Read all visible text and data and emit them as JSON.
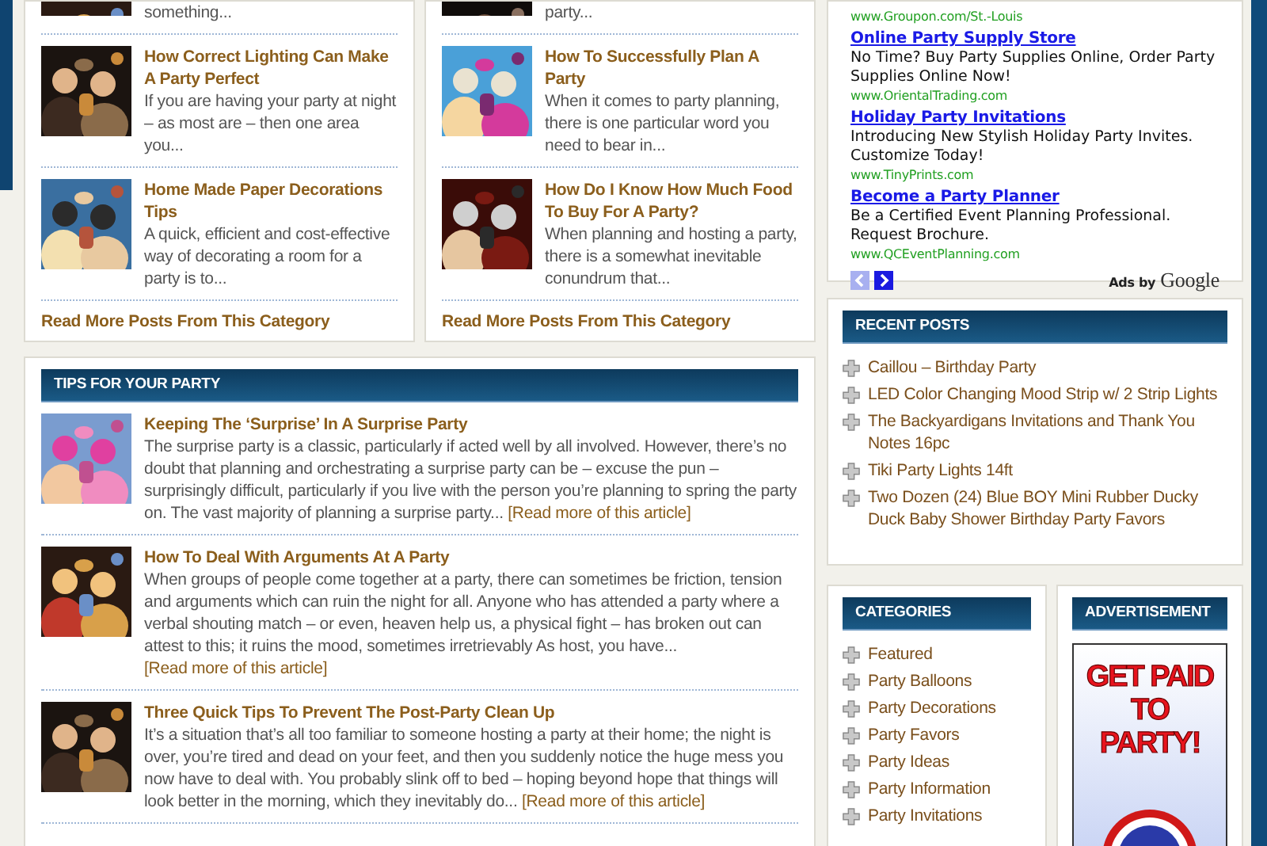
{
  "category_boxes": [
    {
      "posts": [
        {
          "kind": "partial",
          "excerpt": "something..."
        },
        {
          "kind": "post",
          "title": "How Correct Lighting Can Make A Party Perfect",
          "excerpt": "If you are having your party at night – as most are – then one area you..."
        },
        {
          "kind": "post",
          "title": "Home Made Paper Decorations Tips",
          "excerpt": "A quick, efficient and cost-effective way of decorating a room for a party is to..."
        }
      ],
      "read_more": "Read More Posts From This Category"
    },
    {
      "posts": [
        {
          "kind": "partial",
          "excerpt": "party..."
        },
        {
          "kind": "post",
          "title": "How To Successfully Plan A Party",
          "excerpt": "When it comes to party planning, there is one particular word you need to bear in..."
        },
        {
          "kind": "post",
          "title": "How Do I Know How Much Food To Buy For A Party?",
          "excerpt": "When planning and hosting a party, there is a somewhat inevitable conundrum that..."
        }
      ],
      "read_more": "Read More Posts From This Category"
    }
  ],
  "tips": {
    "title": "TIPS FOR YOUR PARTY",
    "posts": [
      {
        "title": "Keeping The ‘Surprise’ In A Surprise Party",
        "excerpt": "The surprise party is a classic, particularly if acted well by all involved. However, there’s no doubt that planning and orchestrating a surprise party can be – excuse the pun – surprisingly difficult, particularly if you live with the person you’re planning to spring the party on. The vast majority of planning a surprise party...",
        "read_more": "[Read more of this article]"
      },
      {
        "title": "How To Deal With Arguments At A Party",
        "excerpt": "When groups of people come together at a party, there can sometimes be friction, tension and arguments which can ruin the night for all. Anyone who has attended a party where a verbal shouting match – or even, heaven help us, a physical fight – has broken out can attest to this; it ruins the mood, sometimes irretrievably As host, you have...",
        "read_more": "[Read more of this article]"
      },
      {
        "title": "Three Quick Tips To Prevent The Post-Party Clean Up",
        "excerpt": "It’s a situation that’s all too familiar to someone hosting a party at their home; the night is over, you’re tired and dead on your feet, and then you suddenly notice the huge mess you now have to deal with. You probably slink off to bed – hoping beyond hope that things will look better in the morning, which they inevitably do...",
        "read_more": "[Read more of this article]"
      }
    ]
  },
  "ads": {
    "items": [
      {
        "url": "www.Groupon.com/St.-Louis"
      },
      {
        "title": "Online Party Supply Store",
        "text": "No Time? Buy Party Supplies Online, Order Party Supplies Online Now!",
        "url": "www.OrientalTrading.com"
      },
      {
        "title": "Holiday Party Invitations",
        "text": "Introducing New Stylish Holiday Party Invites. Customize Today!",
        "url": "www.TinyPrints.com"
      },
      {
        "title": "Become a Party Planner",
        "text": "Be a Certified Event Planning Professional. Request Brochure.",
        "url": "www.QCEventPlanning.com"
      }
    ],
    "pager": [
      {
        "kind": "prev",
        "disabled": true
      },
      {
        "kind": "next",
        "disabled": false
      }
    ],
    "ads_by": "Ads by",
    "brand": "Google"
  },
  "recent_posts": {
    "title": "RECENT POSTS",
    "items": [
      "Caillou – Birthday Party",
      "LED Color Changing Mood Strip w/ 2 Strip Lights",
      "The Backyardigans Invitations and Thank You Notes 16pc",
      "Tiki Party Lights 14ft",
      "Two Dozen (24) Blue BOY Mini Rubber Ducky Duck Baby Shower Birthday Party Favors"
    ]
  },
  "categories": {
    "title": "CATEGORIES",
    "items": [
      "Featured",
      "Party Balloons",
      "Party Decorations",
      "Party Favors",
      "Party Ideas",
      "Party Information",
      "Party Invitations"
    ]
  },
  "advertisement": {
    "title": "ADVERTISEMENT",
    "banner": [
      "GET PAID",
      "TO",
      "PARTY!"
    ]
  }
}
